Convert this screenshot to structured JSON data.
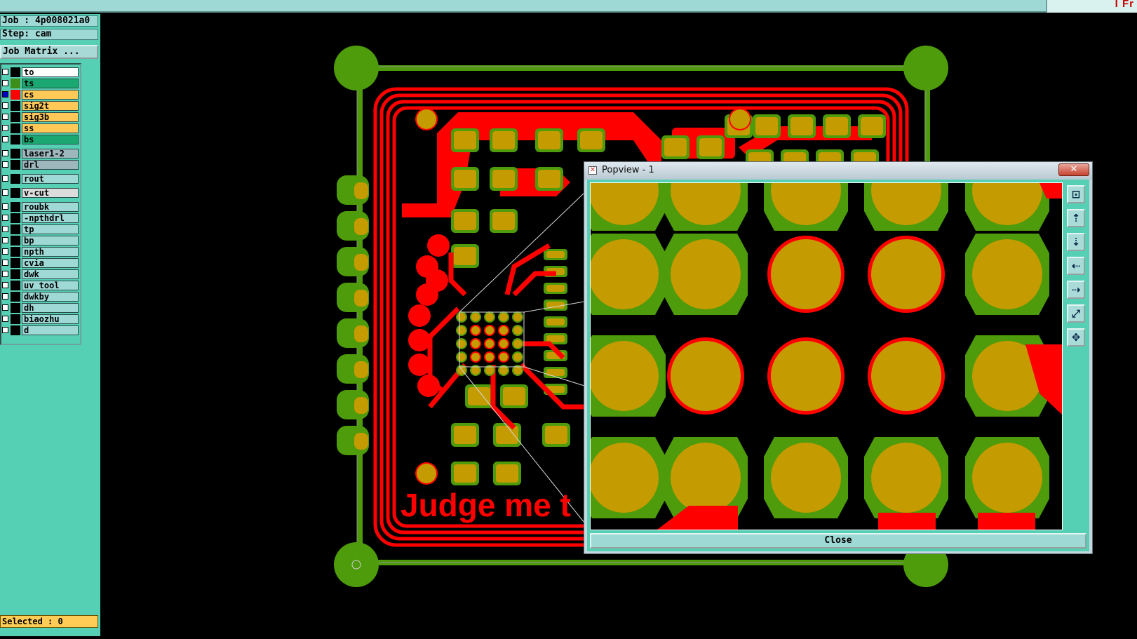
{
  "top_bar": {
    "logo_text": "I Fr"
  },
  "job_info": {
    "job_line": "Job : 4p008021a0",
    "step_line": "Step: cam",
    "matrix_button": "Job Matrix ..."
  },
  "layers": [
    {
      "name": "to",
      "color": "#ffffff",
      "swatch": "#000000",
      "checked": false
    },
    {
      "name": "ts",
      "color": "#1aa870",
      "swatch": "#3d8f1a",
      "checked": false
    },
    {
      "name": "cs",
      "color": "#ffc857",
      "swatch": "#ff0000",
      "checked": true
    },
    {
      "name": "sig2t",
      "color": "#ffc857",
      "swatch": "#000000",
      "checked": false
    },
    {
      "name": "sig3b",
      "color": "#ffc857",
      "swatch": "#000000",
      "checked": false
    },
    {
      "name": "ss",
      "color": "#ffc857",
      "swatch": "#000000",
      "checked": false
    },
    {
      "name": "bs",
      "color": "#1aa870",
      "swatch": "#000000",
      "checked": false
    },
    {
      "name": "laser1-2",
      "color": "#9eb7bd",
      "swatch": "#000000",
      "checked": false
    },
    {
      "name": "drl",
      "color": "#9eb7bd",
      "swatch": "#000000",
      "checked": false
    },
    {
      "name": "rout",
      "color": "#9fd9d6",
      "swatch": "#000000",
      "checked": false
    },
    {
      "name": "v-cut",
      "color": "#dcdcdc",
      "swatch": "#000000",
      "checked": false
    },
    {
      "name": "roubk",
      "color": "#9fd9d6",
      "swatch": "#000000",
      "checked": false
    },
    {
      "name": "-npthdrl",
      "color": "#9fd9d6",
      "swatch": "#000000",
      "checked": false
    },
    {
      "name": "tp",
      "color": "#9fd9d6",
      "swatch": "#000000",
      "checked": false
    },
    {
      "name": "bp",
      "color": "#9fd9d6",
      "swatch": "#000000",
      "checked": false
    },
    {
      "name": "npth",
      "color": "#9fd9d6",
      "swatch": "#000000",
      "checked": false
    },
    {
      "name": "cvia",
      "color": "#9fd9d6",
      "swatch": "#000000",
      "checked": false
    },
    {
      "name": "dwk",
      "color": "#9fd9d6",
      "swatch": "#000000",
      "checked": false
    },
    {
      "name": "uv_tool",
      "color": "#9fd9d6",
      "swatch": "#000000",
      "checked": false
    },
    {
      "name": "dwkby",
      "color": "#9fd9d6",
      "swatch": "#000000",
      "checked": false
    },
    {
      "name": "dh",
      "color": "#9fd9d6",
      "swatch": "#000000",
      "checked": false
    },
    {
      "name": "biaozhu",
      "color": "#9fd9d6",
      "swatch": "#000000",
      "checked": false
    },
    {
      "name": "d",
      "color": "#9fd9d6",
      "swatch": "#000000",
      "checked": false
    }
  ],
  "status": {
    "selected": "Selected : 0"
  },
  "board": {
    "silkscreen_text": "Judge me t"
  },
  "colors": {
    "copper_red": "#ff0000",
    "soldermask_green": "#4e9b0c",
    "pad_gold": "#c49b00",
    "panel_teal": "#56d0b4"
  },
  "popview": {
    "title": "Popview - 1",
    "close_x": "✕",
    "close_button": "Close",
    "tools": [
      "zoom-fit-icon",
      "move-up-icon",
      "move-down-icon",
      "move-left-icon",
      "move-right-icon",
      "zoom-in-icon",
      "zoom-out-icon"
    ]
  }
}
